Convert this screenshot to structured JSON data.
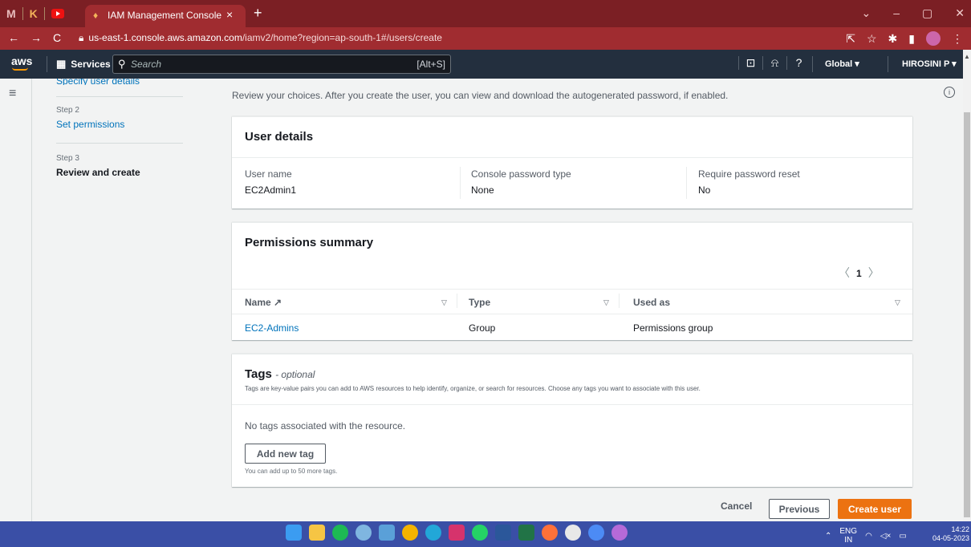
{
  "browser": {
    "tab_title": "IAM Management Console",
    "url_host": "us-east-1.console.aws.amazon.com",
    "url_path": "/iamv2/home?region=ap-south-1#/users/create"
  },
  "aws_nav": {
    "logo": "aws",
    "services_label": "Services",
    "search_placeholder": "Search",
    "search_shortcut": "[Alt+S]",
    "region": "Global ▾",
    "account": "HIROSINI P ▾"
  },
  "steps": {
    "step1_label": "Specify user details",
    "step2_num": "Step 2",
    "step2_label": "Set permissions",
    "step3_num": "Step 3",
    "step3_label": "Review and create"
  },
  "intro": "Review your choices. After you create the user, you can view and download the autogenerated password, if enabled.",
  "user_details": {
    "title": "User details",
    "fields": [
      {
        "key": "User name",
        "value": "EC2Admin1"
      },
      {
        "key": "Console password type",
        "value": "None"
      },
      {
        "key": "Require password reset",
        "value": "No"
      }
    ]
  },
  "permissions": {
    "title": "Permissions summary",
    "page": "1",
    "columns": [
      "Name",
      "Type",
      "Used as"
    ],
    "rows": [
      {
        "name": "EC2-Admins",
        "type": "Group",
        "used_as": "Permissions group"
      }
    ]
  },
  "tags": {
    "title": "Tags",
    "optional": "- optional",
    "description": "Tags are key-value pairs you can add to AWS resources to help identify, organize, or search for resources. Choose any tags you want to associate with this user.",
    "empty": "No tags associated with the resource.",
    "add_button": "Add new tag",
    "note": "You can add up to 50 more tags."
  },
  "actions": {
    "cancel": "Cancel",
    "previous": "Previous",
    "create": "Create user"
  },
  "taskbar": {
    "lang1": "ENG",
    "lang2": "IN",
    "time": "14:22",
    "date": "04-05-2023"
  },
  "colors": {
    "accent": "#ec7211",
    "link": "#0073bb",
    "aws_nav_bg": "#232f3e",
    "browser_bg": "#a02c30"
  }
}
